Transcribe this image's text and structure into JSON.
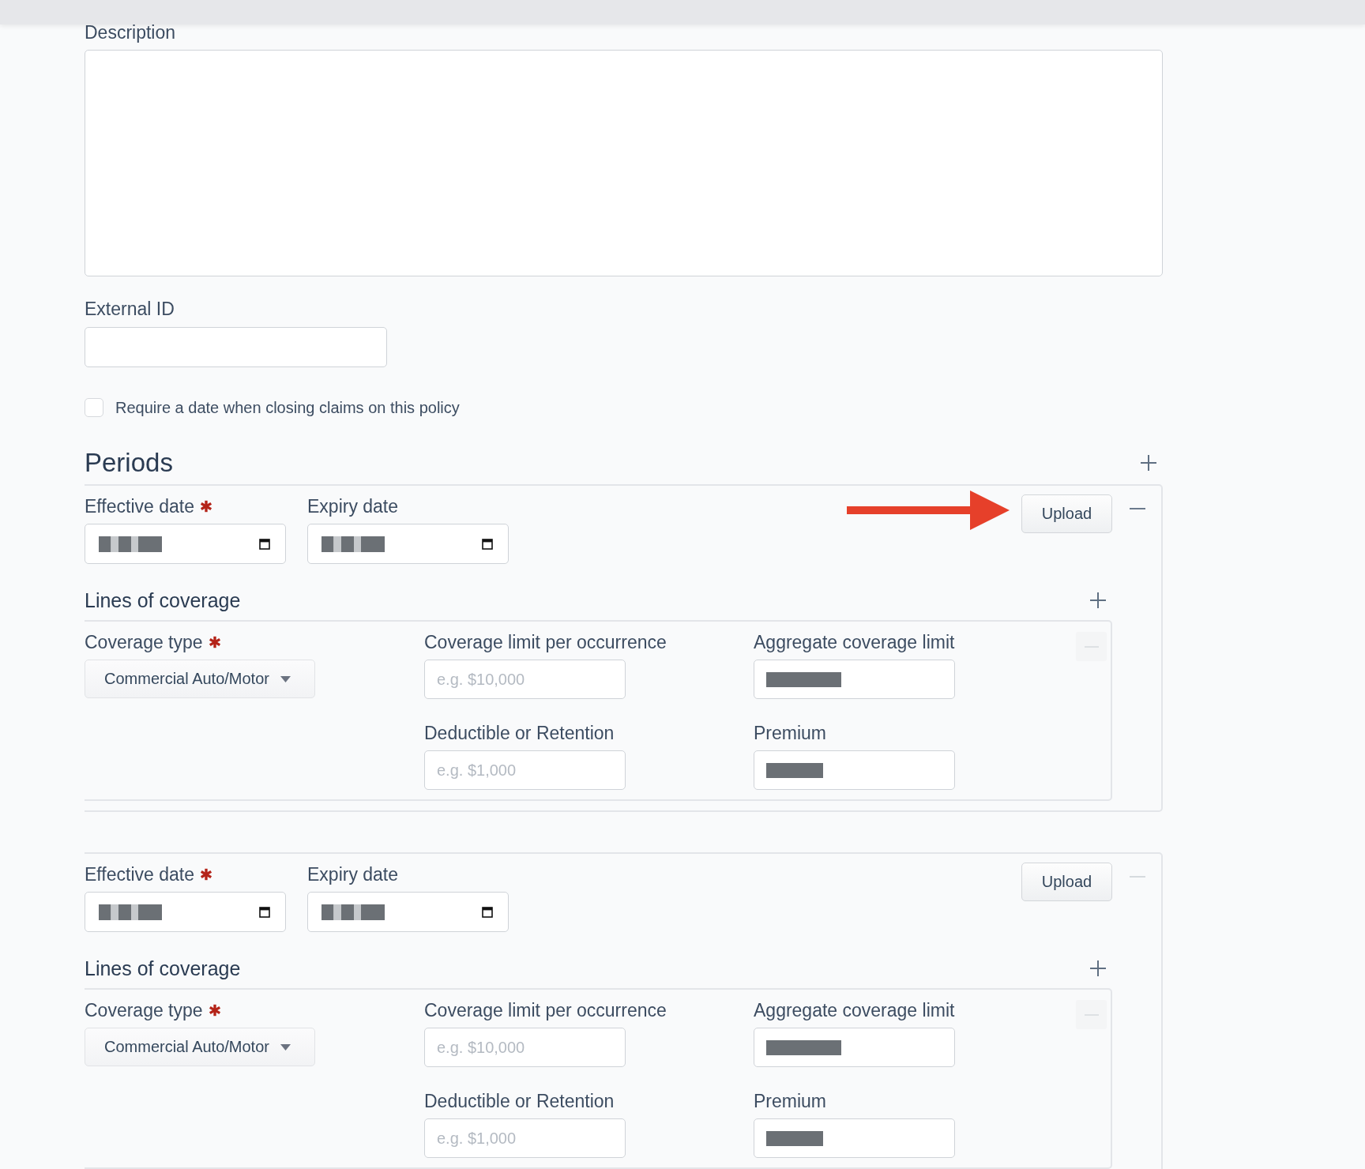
{
  "description": {
    "label": "Description"
  },
  "external_id": {
    "label": "External ID"
  },
  "require_close_date": {
    "label": "Require a date when closing claims on this policy",
    "checked": false
  },
  "periods": {
    "title": "Periods",
    "items": [
      {
        "effective_date": {
          "label": "Effective date",
          "required": true,
          "value_redacted": true
        },
        "expiry_date": {
          "label": "Expiry date",
          "required": false,
          "value_redacted": true
        },
        "callout_arrow": true,
        "upload": "Upload",
        "remove_disabled": false,
        "lines": {
          "title": "Lines of coverage",
          "items": [
            {
              "coverage_type": {
                "label": "Coverage type",
                "required": true,
                "value": "Commercial Auto/Motor"
              },
              "limit_per_occurrence": {
                "label": "Coverage limit per occurrence",
                "required": false,
                "placeholder": "e.g. $10,000"
              },
              "aggregate_limit": {
                "label": "Aggregate coverage limit",
                "required": false,
                "value_redacted": true
              },
              "deductible": {
                "label": "Deductible or Retention",
                "required": false,
                "placeholder": "e.g. $1,000"
              },
              "premium": {
                "label": "Premium",
                "required": false,
                "value_redacted": true
              },
              "remove_disabled": true
            }
          ]
        }
      },
      {
        "effective_date": {
          "label": "Effective date",
          "required": true,
          "value_redacted": true
        },
        "expiry_date": {
          "label": "Expiry date",
          "required": false,
          "value_redacted": true
        },
        "callout_arrow": false,
        "upload": "Upload",
        "remove_disabled": true,
        "lines": {
          "title": "Lines of coverage",
          "items": [
            {
              "coverage_type": {
                "label": "Coverage type",
                "required": true,
                "value": "Commercial Auto/Motor"
              },
              "limit_per_occurrence": {
                "label": "Coverage limit per occurrence",
                "required": false,
                "placeholder": "e.g. $10,000"
              },
              "aggregate_limit": {
                "label": "Aggregate coverage limit",
                "required": false,
                "value_redacted": true
              },
              "deductible": {
                "label": "Deductible or Retention",
                "required": false,
                "placeholder": "e.g. $1,000"
              },
              "premium": {
                "label": "Premium",
                "required": false,
                "value_redacted": true
              },
              "remove_disabled": true
            }
          ]
        }
      }
    ]
  }
}
